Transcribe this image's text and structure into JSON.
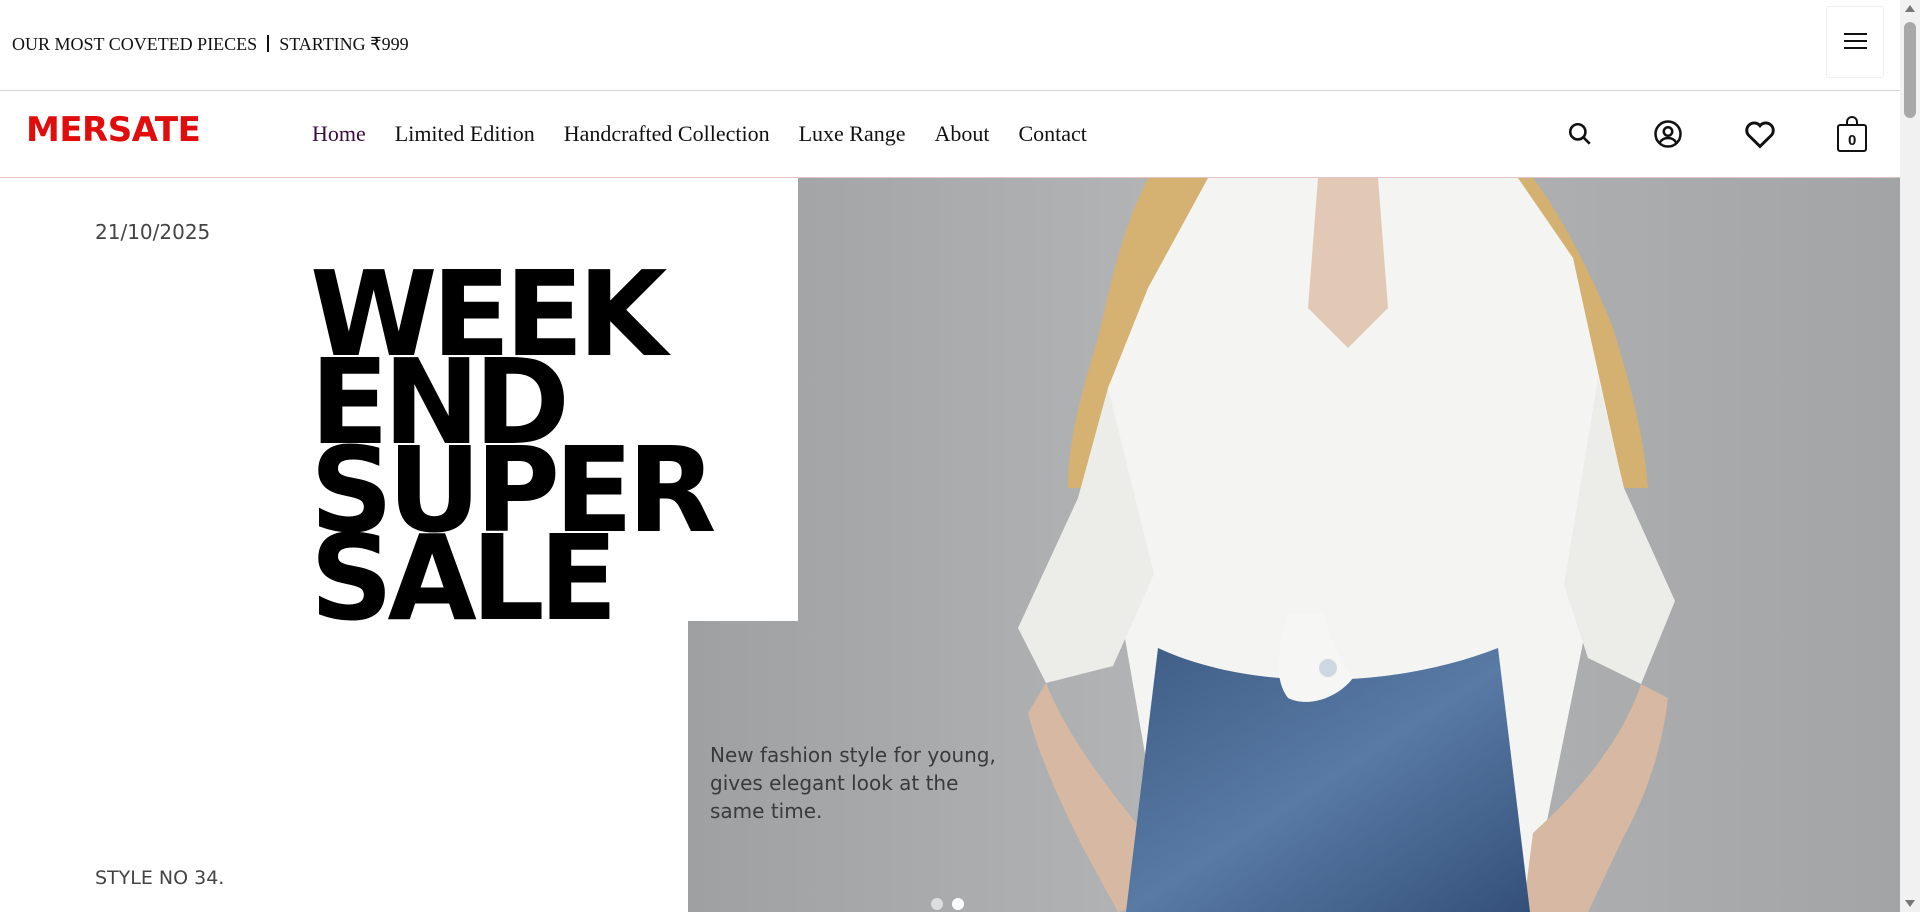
{
  "announcement": {
    "left": "OUR MOST COVETED PIECES",
    "right": "STARTING ₹999"
  },
  "header": {
    "logo": "MERSATE",
    "nav": [
      {
        "label": "Home",
        "active": true
      },
      {
        "label": "Limited Edition"
      },
      {
        "label": "Handcrafted Collection"
      },
      {
        "label": "Luxe Range"
      },
      {
        "label": "About"
      },
      {
        "label": "Contact"
      }
    ],
    "cart_count": "0"
  },
  "hero": {
    "date": "21/10/2025",
    "headline": [
      "WEEK",
      "END",
      "SUPER",
      "SALE"
    ],
    "caption": "New fashion style for young, gives elegant look at the same time.",
    "style_no": "STYLE NO 34.",
    "slide_count": 2,
    "active_slide": 2
  },
  "colors": {
    "brand": "#e10c0c",
    "nav_active": "#3a0b3e",
    "hero_bg": "#a8a9ab"
  },
  "icons": [
    "menu-icon",
    "search-icon",
    "user-icon",
    "heart-icon",
    "bag-icon"
  ]
}
